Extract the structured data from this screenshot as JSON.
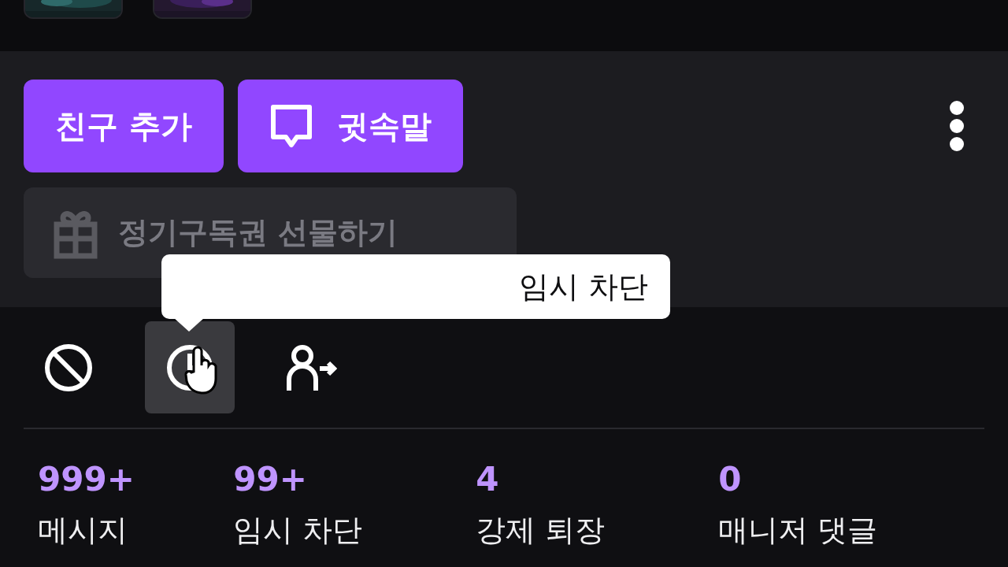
{
  "primary_buttons": [
    {
      "label": "친구 추가",
      "kind": "plain"
    },
    {
      "label": "귓속말",
      "kind": "chat"
    }
  ],
  "gift_button": {
    "label": "정기구독권 선물하기",
    "disabled": true
  },
  "tooltip": {
    "text": "임시 차단"
  },
  "mod_actions": [
    {
      "kind": "ban",
      "selected": false
    },
    {
      "kind": "timeout",
      "selected": true
    },
    {
      "kind": "unfollow",
      "selected": false
    }
  ],
  "stats": [
    {
      "value": "999+",
      "label": "메시지"
    },
    {
      "value": "99+",
      "label": "임시 차단"
    },
    {
      "value": "4",
      "label": "강제 퇴장"
    },
    {
      "value": "0",
      "label": "매니저 댓글"
    }
  ]
}
